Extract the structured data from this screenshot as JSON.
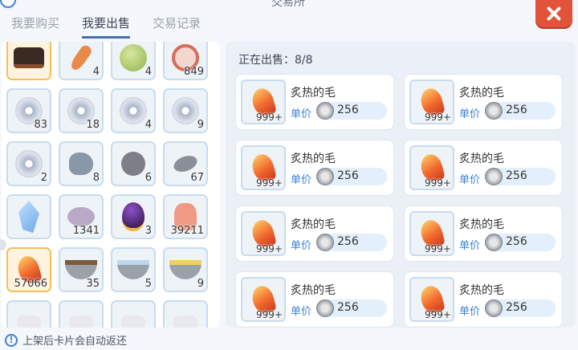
{
  "window": {
    "title": "交易所"
  },
  "tabs": [
    {
      "label": "我要购买",
      "active": false
    },
    {
      "label": "我要出售",
      "active": true
    },
    {
      "label": "交易记录",
      "active": false
    }
  ],
  "inventory": {
    "slots": [
      {
        "item": "hat-icon",
        "count": "",
        "highlight": true
      },
      {
        "item": "carrot-icon",
        "count": "4"
      },
      {
        "item": "apple-icon",
        "count": "4"
      },
      {
        "item": "banned-item-icon",
        "count": "849"
      },
      {
        "item": "disc-icon",
        "count": "83"
      },
      {
        "item": "disc-icon",
        "count": "18"
      },
      {
        "item": "disc-icon",
        "count": "4"
      },
      {
        "item": "disc-icon",
        "count": "9"
      },
      {
        "item": "disc-icon",
        "count": "2"
      },
      {
        "item": "rock-icon",
        "count": "8"
      },
      {
        "item": "stone-ball-icon",
        "count": "6"
      },
      {
        "item": "flat-stone-icon",
        "count": "67"
      },
      {
        "item": "crystal-icon",
        "count": ""
      },
      {
        "item": "pebble-icon",
        "count": "1341"
      },
      {
        "item": "egg-icon",
        "count": "3"
      },
      {
        "item": "fox-icon",
        "count": "39211"
      },
      {
        "item": "feather-icon",
        "count": "57066",
        "highlight": true
      },
      {
        "item": "bowl-icon",
        "count": "35"
      },
      {
        "item": "bowl-icon",
        "count": "5"
      },
      {
        "item": "bowl-icon",
        "count": "9"
      },
      {
        "item": "misc-icon",
        "count": ""
      },
      {
        "item": "misc-icon",
        "count": ""
      },
      {
        "item": "misc-icon",
        "count": ""
      },
      {
        "item": "misc-icon",
        "count": ""
      }
    ]
  },
  "selling": {
    "header": "正在出售：8/8",
    "listings": [
      {
        "name": "炙热的毛",
        "count": "999+",
        "price_label": "单价",
        "price": "256"
      },
      {
        "name": "炙热的毛",
        "count": "999+",
        "price_label": "单价",
        "price": "256"
      },
      {
        "name": "炙热的毛",
        "count": "999+",
        "price_label": "单价",
        "price": "256"
      },
      {
        "name": "炙热的毛",
        "count": "999+",
        "price_label": "单价",
        "price": "256"
      },
      {
        "name": "炙热的毛",
        "count": "999+",
        "price_label": "单价",
        "price": "256"
      },
      {
        "name": "炙热的毛",
        "count": "999+",
        "price_label": "单价",
        "price": "256"
      },
      {
        "name": "炙热的毛",
        "count": "999+",
        "price_label": "单价",
        "price": "256"
      },
      {
        "name": "炙热的毛",
        "count": "999+",
        "price_label": "单价",
        "price": "256"
      }
    ]
  },
  "notice": {
    "text": "上架后卡片会自动返还"
  },
  "colors": {
    "accent": "#3b82d6",
    "close": "#e2543a",
    "highlight": "#f0c05a"
  }
}
